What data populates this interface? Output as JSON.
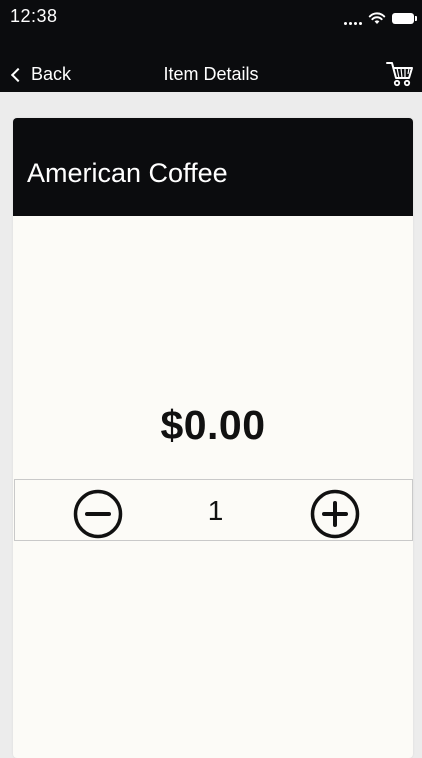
{
  "status_bar": {
    "time": "12:38",
    "icons": [
      "cellular-dots-icon",
      "wifi-icon",
      "battery-icon"
    ]
  },
  "nav": {
    "back_label": "Back",
    "title": "Item Details",
    "cart_icon": "cart-icon"
  },
  "item": {
    "name": "American Coffee",
    "price": "$0.00",
    "quantity": "1"
  },
  "quantity_controls": {
    "decrement_icon": "minus-circle-icon",
    "increment_icon": "plus-circle-icon"
  },
  "colors": {
    "header_bg": "#0b0c0e",
    "card_bg": "#fcfbf7",
    "page_bg": "#ececec",
    "text_dark": "#111111",
    "border": "#c9c9c9"
  }
}
